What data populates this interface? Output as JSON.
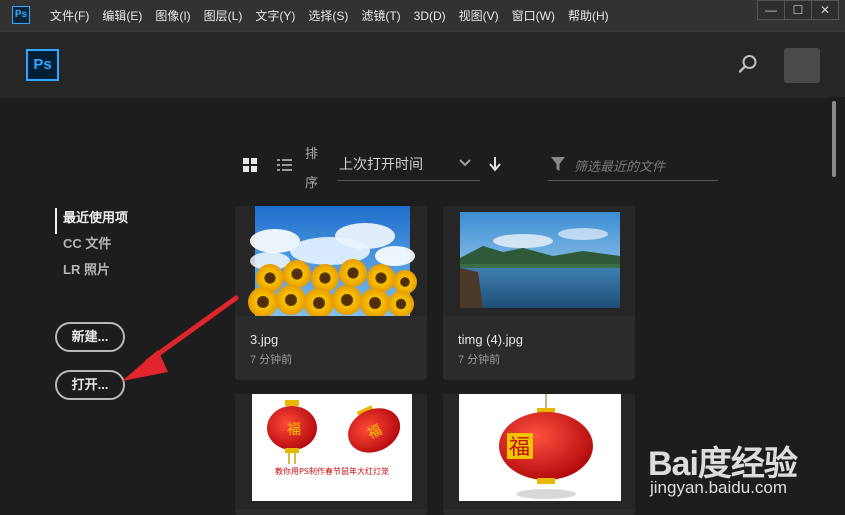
{
  "app": {
    "mini_logo": "Ps",
    "logo": "Ps"
  },
  "menu": [
    "文件(F)",
    "编辑(E)",
    "图像(I)",
    "图层(L)",
    "文字(Y)",
    "选择(S)",
    "滤镜(T)",
    "3D(D)",
    "视图(V)",
    "窗口(W)",
    "帮助(H)"
  ],
  "window_controls": {
    "minimize": "—",
    "maximize": "☐",
    "close": "✕"
  },
  "nav": {
    "recent": "最近使用项",
    "cc_files": "CC 文件",
    "lr_photos": "LR 照片"
  },
  "buttons": {
    "new": "新建...",
    "open": "打开..."
  },
  "toolbar": {
    "sort_label": "排序",
    "sort_value": "上次打开时间",
    "filter_placeholder": "筛选最近的文件"
  },
  "files": [
    {
      "name": "3.jpg",
      "time": "7 分钟前"
    },
    {
      "name": "timg (4).jpg",
      "time": "7 分钟前"
    },
    {
      "banner": "教你用PS制作春节鼠年大红灯笼"
    },
    {}
  ],
  "watermark": {
    "brand": "Bai度经验",
    "url": "jingyan.baidu.com"
  },
  "colors": {
    "accent": "#31a8ff",
    "annotation_arrow": "#e0252c",
    "background": "#1d1d1d"
  }
}
